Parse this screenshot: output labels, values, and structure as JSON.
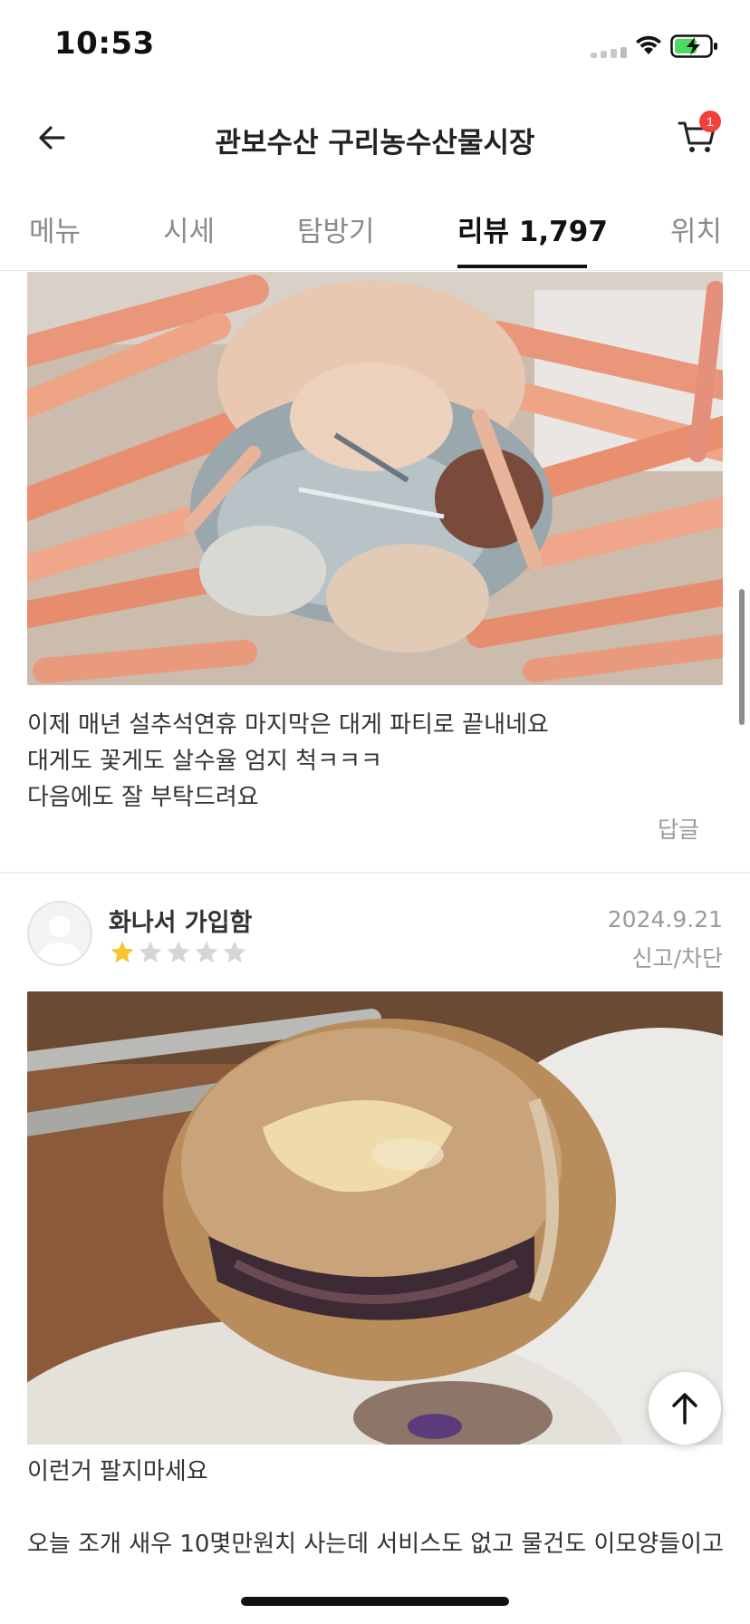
{
  "status_bar": {
    "time": "10:53"
  },
  "header": {
    "title": "관보수산 구리농수산물시장",
    "cart_count": "1"
  },
  "tabs": [
    {
      "label": "메뉴",
      "active": false
    },
    {
      "label": "시세",
      "active": false
    },
    {
      "label": "탐방기",
      "active": false
    },
    {
      "label": "리뷰 1,797",
      "active": true
    },
    {
      "label": "위치",
      "active": false
    }
  ],
  "review1": {
    "lines": [
      "이제 매년 설추석연휴 마지막은 대게 파티로 끝내네요",
      "대게도 꽃게도 살수율 엄지 척ㅋㅋㅋ",
      "다음에도 잘 부탁드려요"
    ],
    "reply_label": "답글"
  },
  "review2": {
    "username": "화나서 가입함",
    "rating": 1,
    "max_rating": 5,
    "date": "2024.9.21",
    "report_label": "신고/차단",
    "lines": [
      "이런거 팔지마세요",
      "",
      "오늘 조개 새우 10몇만원치 사는데 서비스도 없고 물건도 이모양들이고"
    ]
  },
  "colors": {
    "star_filled": "#f7c531",
    "star_empty": "#d6d6d6",
    "badge": "#f0413b",
    "battery": "#4cd964"
  }
}
